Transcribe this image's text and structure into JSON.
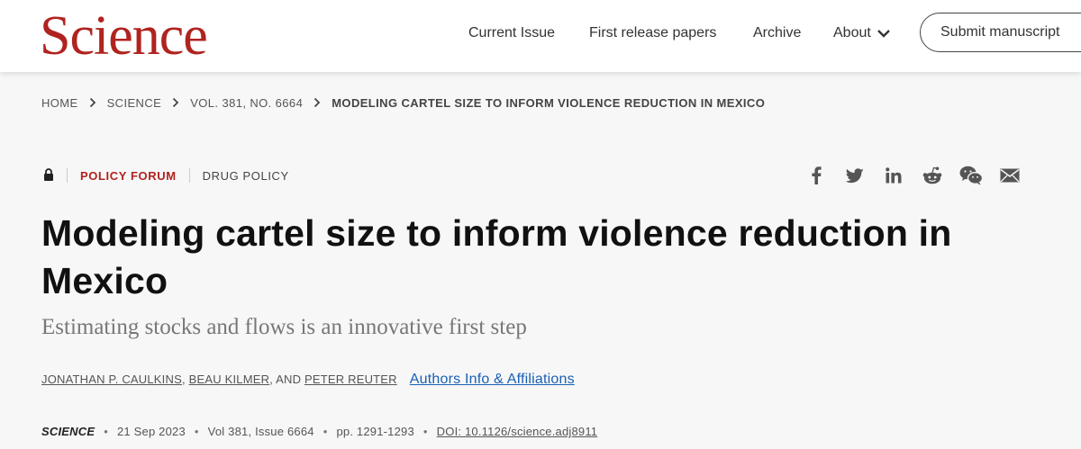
{
  "header": {
    "logo": "Science",
    "nav": [
      {
        "label": "Current Issue"
      },
      {
        "label": "First release papers"
      },
      {
        "label": "Archive"
      },
      {
        "label": "About"
      }
    ],
    "submit_label": "Submit manuscript"
  },
  "breadcrumb": [
    {
      "label": "HOME"
    },
    {
      "label": "SCIENCE"
    },
    {
      "label": "VOL. 381, NO. 6664"
    },
    {
      "label": "MODELING CARTEL SIZE TO INFORM VIOLENCE REDUCTION IN MEXICO"
    }
  ],
  "article": {
    "section": "POLICY FORUM",
    "subject": "DRUG POLICY",
    "title": "Modeling cartel size to inform violence reduction in Mexico",
    "subtitle": "Estimating stocks and flows is an innovative first step",
    "authors": [
      "JONATHAN P. CAULKINS",
      "BEAU KILMER",
      "PETER REUTER"
    ],
    "author_sep1": ", ",
    "author_sep2": ", AND ",
    "authors_info": "Authors Info & Affiliations",
    "journal": "SCIENCE",
    "date": "21 Sep 2023",
    "volume": "Vol 381, Issue 6664",
    "pages": "pp. 1291-1293",
    "doi": "DOI: 10.1126/science.adj8911"
  },
  "share_icons": [
    "facebook-icon",
    "twitter-icon",
    "linkedin-icon",
    "reddit-icon",
    "wechat-icon",
    "email-icon"
  ],
  "colors": {
    "brand": "#b0231f",
    "link": "#1a5fb4",
    "background": "#f7f7f7"
  }
}
